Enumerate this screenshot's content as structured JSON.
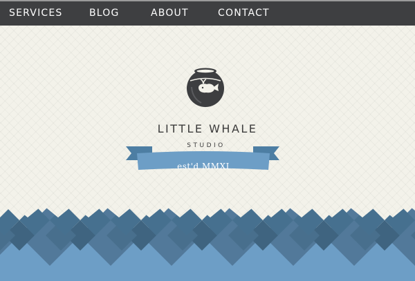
{
  "nav": {
    "items": [
      {
        "label": "SERVICES"
      },
      {
        "label": "BLOG"
      },
      {
        "label": "ABOUT"
      },
      {
        "label": "CONTACT"
      }
    ]
  },
  "brand": {
    "title": "LITTLE WHALE",
    "subtitle": "STUDIO",
    "established": "est'd MMXI",
    "logo_icon": "whale-fishbowl-icon"
  },
  "colors": {
    "nav_background": "#3e3f41",
    "page_background": "#f3f2ea",
    "ribbon_blue": "#6d9ec6",
    "ribbon_dark": "#4d7ea3",
    "pattern_dark": "#3f6480",
    "pattern_mid": "#52799a",
    "pattern_light": "#6d9ec6"
  }
}
